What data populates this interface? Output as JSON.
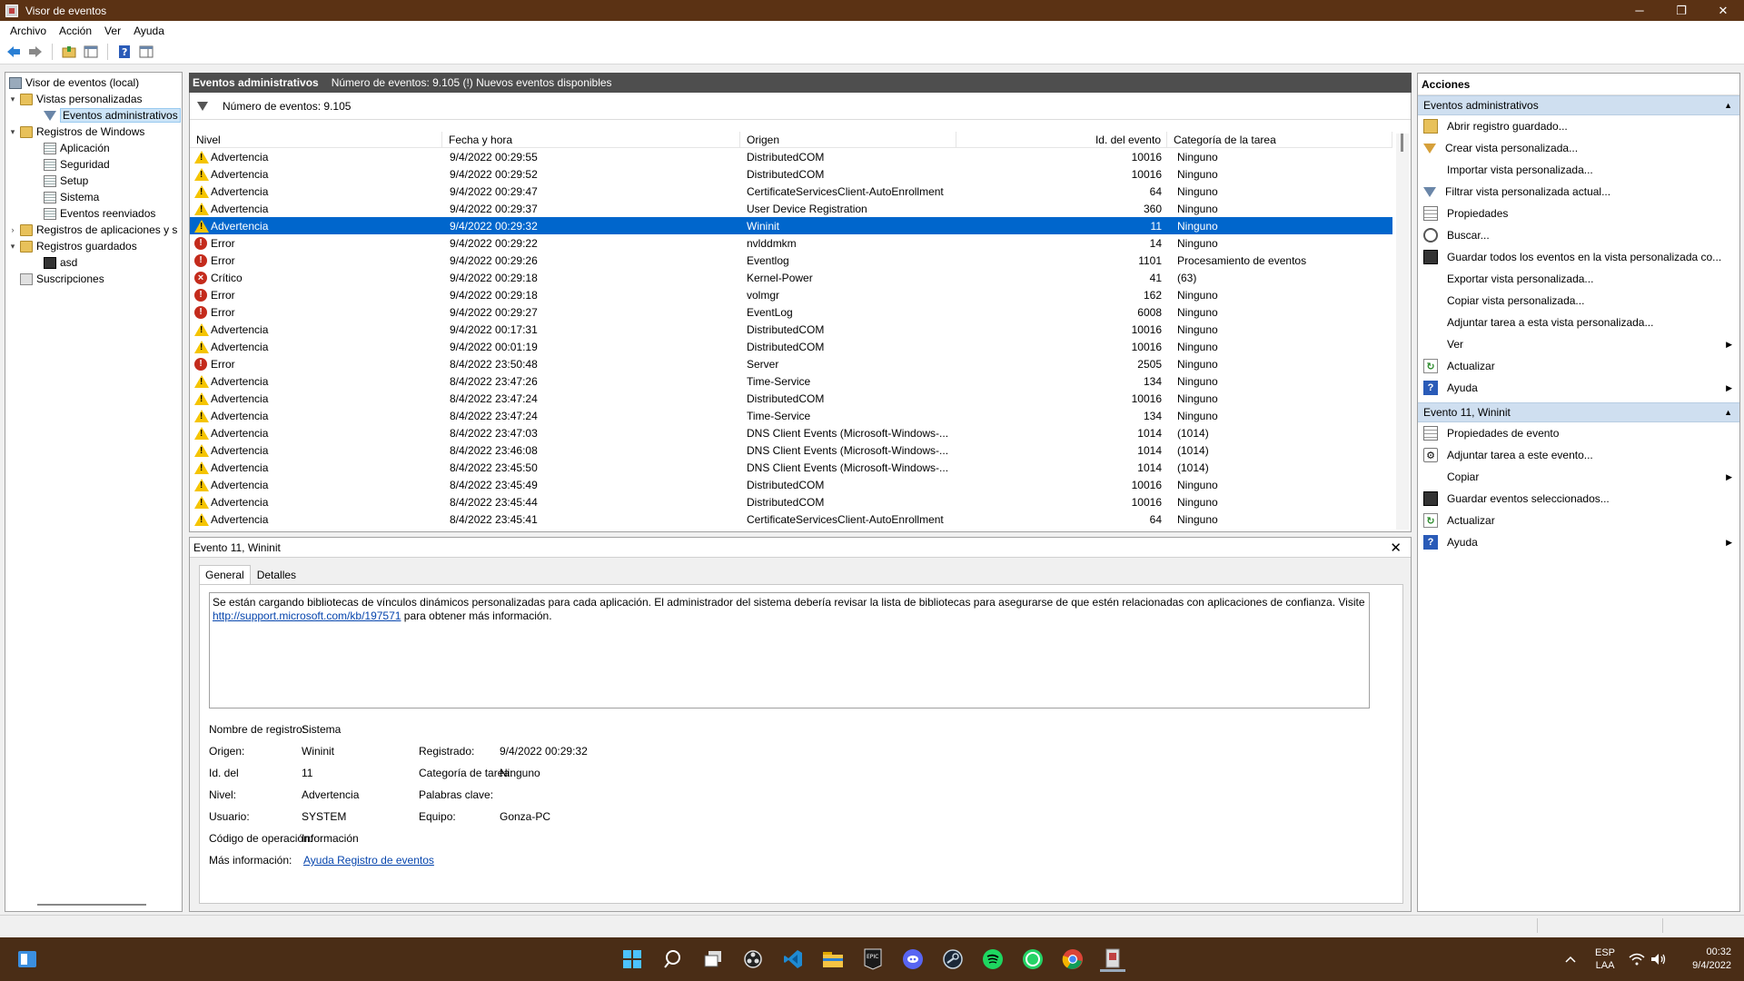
{
  "window": {
    "title": "Visor de eventos",
    "minimize": "─",
    "restore": "❐",
    "close": "✕"
  },
  "menu": [
    "Archivo",
    "Acción",
    "Ver",
    "Ayuda"
  ],
  "toolbar": {
    "icons": [
      "back-arrow-icon",
      "forward-arrow-icon",
      "open-folder-icon",
      "console-tree-icon",
      "help-icon",
      "action-pane-icon"
    ]
  },
  "tree": {
    "root": "Visor de eventos (local)",
    "custom_views": "Vistas personalizadas",
    "admin_events": "Eventos administrativos",
    "windows_logs": "Registros de Windows",
    "logs": [
      "Aplicación",
      "Seguridad",
      "Setup",
      "Sistema",
      "Eventos reenviados"
    ],
    "app_service_logs": "Registros de aplicaciones y s",
    "saved_logs": "Registros guardados",
    "saved_items": [
      "asd"
    ],
    "subscriptions": "Suscripciones"
  },
  "center": {
    "header_title": "Eventos administrativos",
    "header_info": "Número de eventos: 9.105 (!) Nuevos eventos disponibles",
    "filter_text": "Número de eventos: 9.105",
    "columns": [
      "Nivel",
      "Fecha y hora",
      "Origen",
      "Id. del evento",
      "Categoría de la tarea"
    ],
    "rows": [
      {
        "level": "Advertencia",
        "type": "warn",
        "date": "9/4/2022 00:29:55",
        "source": "DistributedCOM",
        "id": "10016",
        "cat": "Ninguno"
      },
      {
        "level": "Advertencia",
        "type": "warn",
        "date": "9/4/2022 00:29:52",
        "source": "DistributedCOM",
        "id": "10016",
        "cat": "Ninguno"
      },
      {
        "level": "Advertencia",
        "type": "warn",
        "date": "9/4/2022 00:29:47",
        "source": "CertificateServicesClient-AutoEnrollment",
        "id": "64",
        "cat": "Ninguno"
      },
      {
        "level": "Advertencia",
        "type": "warn",
        "date": "9/4/2022 00:29:37",
        "source": "User Device Registration",
        "id": "360",
        "cat": "Ninguno"
      },
      {
        "level": "Advertencia",
        "type": "warn",
        "date": "9/4/2022 00:29:32",
        "source": "Wininit",
        "id": "11",
        "cat": "Ninguno",
        "selected": true
      },
      {
        "level": "Error",
        "type": "err",
        "date": "9/4/2022 00:29:22",
        "source": "nvlddmkm",
        "id": "14",
        "cat": "Ninguno"
      },
      {
        "level": "Error",
        "type": "err",
        "date": "9/4/2022 00:29:26",
        "source": "Eventlog",
        "id": "1101",
        "cat": "Procesamiento de eventos"
      },
      {
        "level": "Crítico",
        "type": "crit",
        "date": "9/4/2022 00:29:18",
        "source": "Kernel-Power",
        "id": "41",
        "cat": "(63)"
      },
      {
        "level": "Error",
        "type": "err",
        "date": "9/4/2022 00:29:18",
        "source": "volmgr",
        "id": "162",
        "cat": "Ninguno"
      },
      {
        "level": "Error",
        "type": "err",
        "date": "9/4/2022 00:29:27",
        "source": "EventLog",
        "id": "6008",
        "cat": "Ninguno"
      },
      {
        "level": "Advertencia",
        "type": "warn",
        "date": "9/4/2022 00:17:31",
        "source": "DistributedCOM",
        "id": "10016",
        "cat": "Ninguno"
      },
      {
        "level": "Advertencia",
        "type": "warn",
        "date": "9/4/2022 00:01:19",
        "source": "DistributedCOM",
        "id": "10016",
        "cat": "Ninguno"
      },
      {
        "level": "Error",
        "type": "err",
        "date": "8/4/2022 23:50:48",
        "source": "Server",
        "id": "2505",
        "cat": "Ninguno"
      },
      {
        "level": "Advertencia",
        "type": "warn",
        "date": "8/4/2022 23:47:26",
        "source": "Time-Service",
        "id": "134",
        "cat": "Ninguno"
      },
      {
        "level": "Advertencia",
        "type": "warn",
        "date": "8/4/2022 23:47:24",
        "source": "DistributedCOM",
        "id": "10016",
        "cat": "Ninguno"
      },
      {
        "level": "Advertencia",
        "type": "warn",
        "date": "8/4/2022 23:47:24",
        "source": "Time-Service",
        "id": "134",
        "cat": "Ninguno"
      },
      {
        "level": "Advertencia",
        "type": "warn",
        "date": "8/4/2022 23:47:03",
        "source": "DNS Client Events (Microsoft-Windows-...",
        "id": "1014",
        "cat": "(1014)"
      },
      {
        "level": "Advertencia",
        "type": "warn",
        "date": "8/4/2022 23:46:08",
        "source": "DNS Client Events (Microsoft-Windows-...",
        "id": "1014",
        "cat": "(1014)"
      },
      {
        "level": "Advertencia",
        "type": "warn",
        "date": "8/4/2022 23:45:50",
        "source": "DNS Client Events (Microsoft-Windows-...",
        "id": "1014",
        "cat": "(1014)"
      },
      {
        "level": "Advertencia",
        "type": "warn",
        "date": "8/4/2022 23:45:49",
        "source": "DistributedCOM",
        "id": "10016",
        "cat": "Ninguno"
      },
      {
        "level": "Advertencia",
        "type": "warn",
        "date": "8/4/2022 23:45:44",
        "source": "DistributedCOM",
        "id": "10016",
        "cat": "Ninguno"
      },
      {
        "level": "Advertencia",
        "type": "warn",
        "date": "8/4/2022 23:45:41",
        "source": "CertificateServicesClient-AutoEnrollment",
        "id": "64",
        "cat": "Ninguno"
      }
    ]
  },
  "detail": {
    "title": "Evento 11, Wininit",
    "close": "✕",
    "tabs": [
      "General",
      "Detalles"
    ],
    "description_1": "Se están cargando bibliotecas de vínculos dinámicos personalizadas para cada aplicación. El administrador del sistema debería revisar la lista de bibliotecas para asegurarse de que estén relacionadas con aplicaciones de confianza. Visite",
    "description_link": "http://support.microsoft.com/kb/197571",
    "description_2": " para obtener más información.",
    "props": {
      "log_name_label": "Nombre de registro:",
      "log_name": "Sistema",
      "source_label": "Origen:",
      "source": "Wininit",
      "logged_label": "Registrado:",
      "logged": "9/4/2022 00:29:32",
      "event_id_label": "Id. del",
      "event_id": "11",
      "task_cat_label": "Categoría de tarea:",
      "task_cat": "Ninguno",
      "level_label": "Nivel:",
      "level": "Advertencia",
      "keywords_label": "Palabras clave:",
      "keywords": "",
      "user_label": "Usuario:",
      "user": "SYSTEM",
      "computer_label": "Equipo:",
      "computer": "Gonza-PC",
      "opcode_label": "Código de operación:",
      "opcode": "Información",
      "more_info_label": "Más información:",
      "more_info": "Ayuda Registro de eventos"
    }
  },
  "actions": {
    "title": "Acciones",
    "section1": "Eventos administrativos",
    "section1_items": [
      {
        "label": "Abrir registro guardado...",
        "icon": "open-folder-icon",
        "cls": "ai-open"
      },
      {
        "label": "Crear vista personalizada...",
        "icon": "create-filter-icon",
        "cls": "ai-funnel-o"
      },
      {
        "label": "Importar vista personalizada...",
        "icon": "none",
        "cls": "ai-blank"
      },
      {
        "label": "Filtrar vista personalizada actual...",
        "icon": "filter-icon",
        "cls": "ai-funnel"
      },
      {
        "label": "Propiedades",
        "icon": "properties-icon",
        "cls": "ai-props"
      },
      {
        "label": "Buscar...",
        "icon": "find-icon",
        "cls": "ai-find"
      },
      {
        "label": "Guardar todos los eventos en la vista personalizada co...",
        "icon": "save-icon",
        "cls": "ai-save"
      },
      {
        "label": "Exportar vista personalizada...",
        "icon": "none",
        "cls": "ai-blank"
      },
      {
        "label": "Copiar vista personalizada...",
        "icon": "none",
        "cls": "ai-blank"
      },
      {
        "label": "Adjuntar tarea a esta vista personalizada...",
        "icon": "none",
        "cls": "ai-blank"
      },
      {
        "label": "Ver",
        "icon": "none",
        "cls": "ai-blank",
        "submenu": true
      },
      {
        "label": "Actualizar",
        "icon": "refresh-icon",
        "cls": "ai-refresh",
        "glyph": "↻"
      },
      {
        "label": "Ayuda",
        "icon": "help-icon",
        "cls": "ai-help",
        "glyph": "?",
        "submenu": true
      }
    ],
    "section2": "Evento 11, Wininit",
    "section2_items": [
      {
        "label": "Propiedades de evento",
        "icon": "event-properties-icon",
        "cls": "ai-props"
      },
      {
        "label": "Adjuntar tarea a este evento...",
        "icon": "attach-task-icon",
        "cls": "ai-task",
        "glyph": "⚙"
      },
      {
        "label": "Copiar",
        "icon": "copy-icon",
        "cls": "ai-blank",
        "submenu": true
      },
      {
        "label": "Guardar eventos seleccionados...",
        "icon": "save-icon",
        "cls": "ai-save"
      },
      {
        "label": "Actualizar",
        "icon": "refresh-icon",
        "cls": "ai-refresh",
        "glyph": "↻"
      },
      {
        "label": "Ayuda",
        "icon": "help-icon",
        "cls": "ai-help",
        "glyph": "?",
        "submenu": true
      }
    ]
  },
  "taskbar": {
    "apps": [
      "widgets-icon",
      "start-icon",
      "search-icon",
      "task-view-icon",
      "obs-icon",
      "vscode-icon",
      "file-explorer-icon",
      "epic-games-icon",
      "discord-icon",
      "steam-icon",
      "spotify-icon",
      "whatsapp-icon",
      "chrome-icon",
      "event-viewer-icon"
    ],
    "lang1": "ESP",
    "lang2": "LAA",
    "time": "00:32",
    "date": "9/4/2022"
  }
}
